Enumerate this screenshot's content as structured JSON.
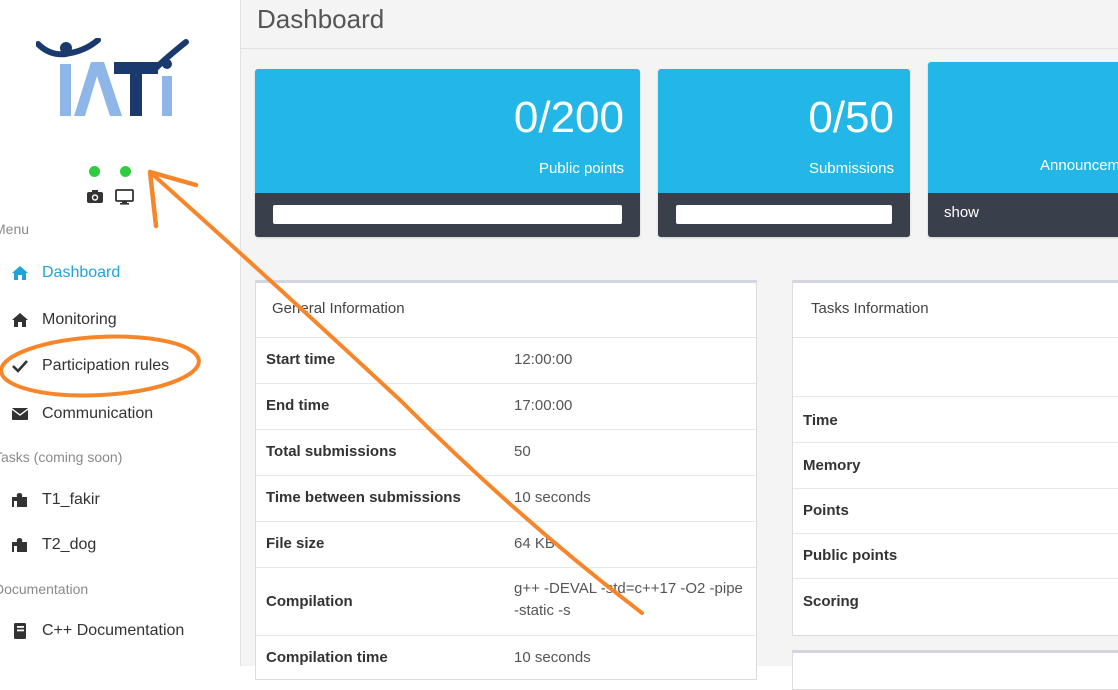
{
  "sidebar": {
    "menu_label": "Menu",
    "tasks_label": "Tasks (coming soon)",
    "documentation_label": "Documentation",
    "items": [
      {
        "label": "Dashboard",
        "icon": "home-icon"
      },
      {
        "label": "Monitoring",
        "icon": "home-icon"
      },
      {
        "label": "Participation rules",
        "icon": "check-icon"
      },
      {
        "label": "Communication",
        "icon": "envelope-icon"
      },
      {
        "label": "T1_fakir",
        "icon": "puzzle-icon"
      },
      {
        "label": "T2_dog",
        "icon": "puzzle-icon"
      },
      {
        "label": "C++ Documentation",
        "icon": "book-icon"
      }
    ]
  },
  "header": {
    "title": "Dashboard"
  },
  "stats": [
    {
      "value": "0/200",
      "label": "Public points",
      "progress": 0
    },
    {
      "value": "0/50",
      "label": "Submissions",
      "progress": 0
    },
    {
      "value": "",
      "label": "Announcements",
      "link": "show"
    }
  ],
  "general": {
    "title": "General Information",
    "rows": [
      {
        "label": "Start time",
        "value": "12:00:00"
      },
      {
        "label": "End time",
        "value": "17:00:00"
      },
      {
        "label": "Total submissions",
        "value": "50"
      },
      {
        "label": "Time between submissions",
        "value": "10 seconds"
      },
      {
        "label": "File size",
        "value": "64 KB"
      },
      {
        "label": "Compilation",
        "value": "g++ -DEVAL -std=c++17 -O2 -pipe -static -s"
      },
      {
        "label": "Compilation time",
        "value": "10 seconds"
      }
    ]
  },
  "tasks": {
    "title": "Tasks Information",
    "rows": [
      {
        "label": "Time"
      },
      {
        "label": "Memory"
      },
      {
        "label": "Points"
      },
      {
        "label": "Public points"
      },
      {
        "label": "Scoring"
      }
    ]
  },
  "colors": {
    "accent": "#22b7e6",
    "active": "#1fa3d8",
    "footer": "#3a3f4c",
    "status_dot": "#2ecc40",
    "annotation": "#f7862a"
  }
}
